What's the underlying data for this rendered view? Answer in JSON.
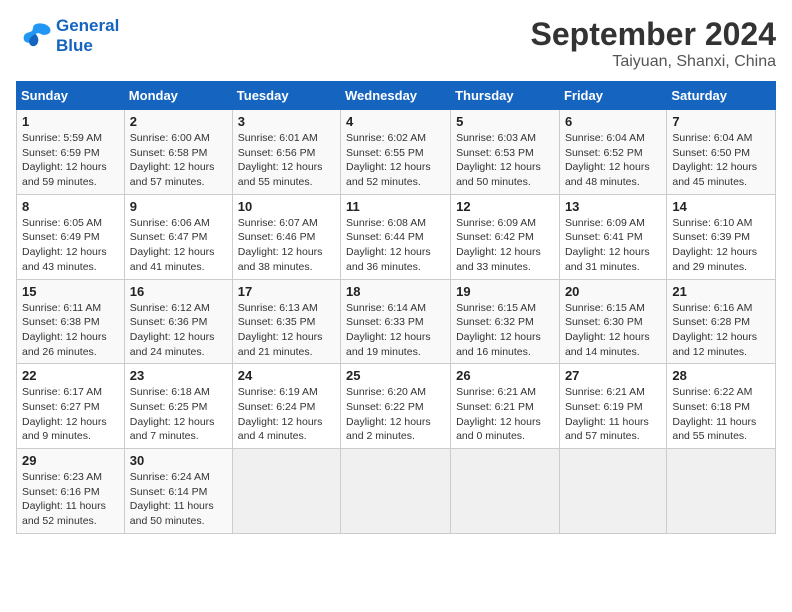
{
  "logo": {
    "line1": "General",
    "line2": "Blue"
  },
  "title": "September 2024",
  "subtitle": "Taiyuan, Shanxi, China",
  "days_of_week": [
    "Sunday",
    "Monday",
    "Tuesday",
    "Wednesday",
    "Thursday",
    "Friday",
    "Saturday"
  ],
  "weeks": [
    [
      {
        "day": "1",
        "sunrise": "5:59 AM",
        "sunset": "6:59 PM",
        "daylight": "12 hours and 59 minutes."
      },
      {
        "day": "2",
        "sunrise": "6:00 AM",
        "sunset": "6:58 PM",
        "daylight": "12 hours and 57 minutes."
      },
      {
        "day": "3",
        "sunrise": "6:01 AM",
        "sunset": "6:56 PM",
        "daylight": "12 hours and 55 minutes."
      },
      {
        "day": "4",
        "sunrise": "6:02 AM",
        "sunset": "6:55 PM",
        "daylight": "12 hours and 52 minutes."
      },
      {
        "day": "5",
        "sunrise": "6:03 AM",
        "sunset": "6:53 PM",
        "daylight": "12 hours and 50 minutes."
      },
      {
        "day": "6",
        "sunrise": "6:04 AM",
        "sunset": "6:52 PM",
        "daylight": "12 hours and 48 minutes."
      },
      {
        "day": "7",
        "sunrise": "6:04 AM",
        "sunset": "6:50 PM",
        "daylight": "12 hours and 45 minutes."
      }
    ],
    [
      {
        "day": "8",
        "sunrise": "6:05 AM",
        "sunset": "6:49 PM",
        "daylight": "12 hours and 43 minutes."
      },
      {
        "day": "9",
        "sunrise": "6:06 AM",
        "sunset": "6:47 PM",
        "daylight": "12 hours and 41 minutes."
      },
      {
        "day": "10",
        "sunrise": "6:07 AM",
        "sunset": "6:46 PM",
        "daylight": "12 hours and 38 minutes."
      },
      {
        "day": "11",
        "sunrise": "6:08 AM",
        "sunset": "6:44 PM",
        "daylight": "12 hours and 36 minutes."
      },
      {
        "day": "12",
        "sunrise": "6:09 AM",
        "sunset": "6:42 PM",
        "daylight": "12 hours and 33 minutes."
      },
      {
        "day": "13",
        "sunrise": "6:09 AM",
        "sunset": "6:41 PM",
        "daylight": "12 hours and 31 minutes."
      },
      {
        "day": "14",
        "sunrise": "6:10 AM",
        "sunset": "6:39 PM",
        "daylight": "12 hours and 29 minutes."
      }
    ],
    [
      {
        "day": "15",
        "sunrise": "6:11 AM",
        "sunset": "6:38 PM",
        "daylight": "12 hours and 26 minutes."
      },
      {
        "day": "16",
        "sunrise": "6:12 AM",
        "sunset": "6:36 PM",
        "daylight": "12 hours and 24 minutes."
      },
      {
        "day": "17",
        "sunrise": "6:13 AM",
        "sunset": "6:35 PM",
        "daylight": "12 hours and 21 minutes."
      },
      {
        "day": "18",
        "sunrise": "6:14 AM",
        "sunset": "6:33 PM",
        "daylight": "12 hours and 19 minutes."
      },
      {
        "day": "19",
        "sunrise": "6:15 AM",
        "sunset": "6:32 PM",
        "daylight": "12 hours and 16 minutes."
      },
      {
        "day": "20",
        "sunrise": "6:15 AM",
        "sunset": "6:30 PM",
        "daylight": "12 hours and 14 minutes."
      },
      {
        "day": "21",
        "sunrise": "6:16 AM",
        "sunset": "6:28 PM",
        "daylight": "12 hours and 12 minutes."
      }
    ],
    [
      {
        "day": "22",
        "sunrise": "6:17 AM",
        "sunset": "6:27 PM",
        "daylight": "12 hours and 9 minutes."
      },
      {
        "day": "23",
        "sunrise": "6:18 AM",
        "sunset": "6:25 PM",
        "daylight": "12 hours and 7 minutes."
      },
      {
        "day": "24",
        "sunrise": "6:19 AM",
        "sunset": "6:24 PM",
        "daylight": "12 hours and 4 minutes."
      },
      {
        "day": "25",
        "sunrise": "6:20 AM",
        "sunset": "6:22 PM",
        "daylight": "12 hours and 2 minutes."
      },
      {
        "day": "26",
        "sunrise": "6:21 AM",
        "sunset": "6:21 PM",
        "daylight": "12 hours and 0 minutes."
      },
      {
        "day": "27",
        "sunrise": "6:21 AM",
        "sunset": "6:19 PM",
        "daylight": "11 hours and 57 minutes."
      },
      {
        "day": "28",
        "sunrise": "6:22 AM",
        "sunset": "6:18 PM",
        "daylight": "11 hours and 55 minutes."
      }
    ],
    [
      {
        "day": "29",
        "sunrise": "6:23 AM",
        "sunset": "6:16 PM",
        "daylight": "11 hours and 52 minutes."
      },
      {
        "day": "30",
        "sunrise": "6:24 AM",
        "sunset": "6:14 PM",
        "daylight": "11 hours and 50 minutes."
      },
      null,
      null,
      null,
      null,
      null
    ]
  ]
}
